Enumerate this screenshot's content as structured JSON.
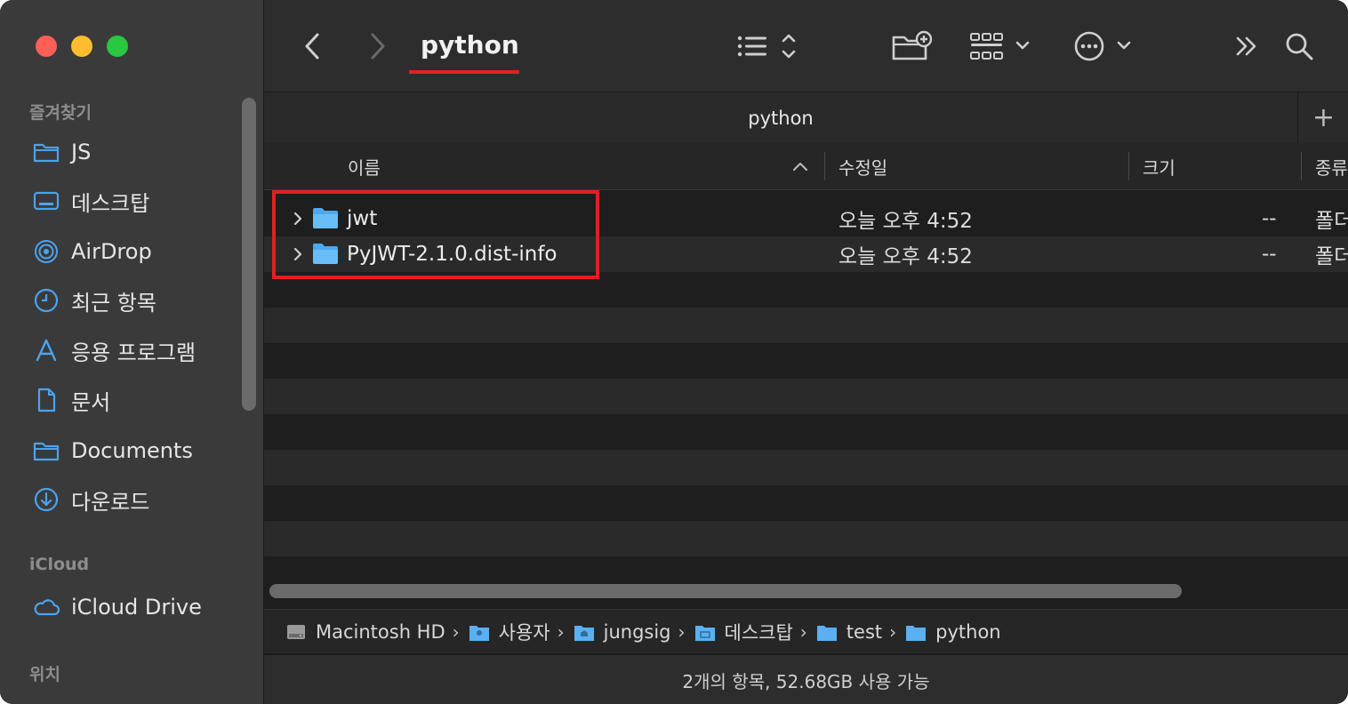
{
  "window_controls": {
    "close": "close",
    "minimize": "minimize",
    "zoom": "zoom"
  },
  "sidebar": {
    "favorites_header": "즐겨찾기",
    "items": [
      {
        "label": "JS",
        "icon": "folder-icon"
      },
      {
        "label": "데스크탑",
        "icon": "desktop-icon"
      },
      {
        "label": "AirDrop",
        "icon": "airdrop-icon"
      },
      {
        "label": "최근 항목",
        "icon": "clock-icon"
      },
      {
        "label": "응용 프로그램",
        "icon": "applications-icon"
      },
      {
        "label": "문서",
        "icon": "document-icon"
      },
      {
        "label": "Documents",
        "icon": "folder-icon"
      },
      {
        "label": "다운로드",
        "icon": "download-icon"
      }
    ],
    "icloud_header": "iCloud",
    "icloud_items": [
      {
        "label": "iCloud Drive",
        "icon": "cloud-icon"
      }
    ],
    "locations_header": "위치"
  },
  "toolbar": {
    "title": "python"
  },
  "tab": {
    "label": "python",
    "add_label": "+"
  },
  "columns": {
    "name": "이름",
    "date": "수정일",
    "size": "크기",
    "kind": "종류"
  },
  "files": [
    {
      "name": "jwt",
      "date": "오늘 오후 4:52",
      "size": "--",
      "kind": "폴더"
    },
    {
      "name": "PyJWT-2.1.0.dist-info",
      "date": "오늘 오후 4:52",
      "size": "--",
      "kind": "폴더"
    }
  ],
  "pathbar": {
    "crumbs": [
      "Macintosh HD",
      "사용자",
      "jungsig",
      "데스크탑",
      "test",
      "python"
    ]
  },
  "status": {
    "text": "2개의 항목, 52.68GB 사용 가능"
  },
  "colors": {
    "accent_folder": "#5ab0f0",
    "annotation_red": "#e02020"
  }
}
